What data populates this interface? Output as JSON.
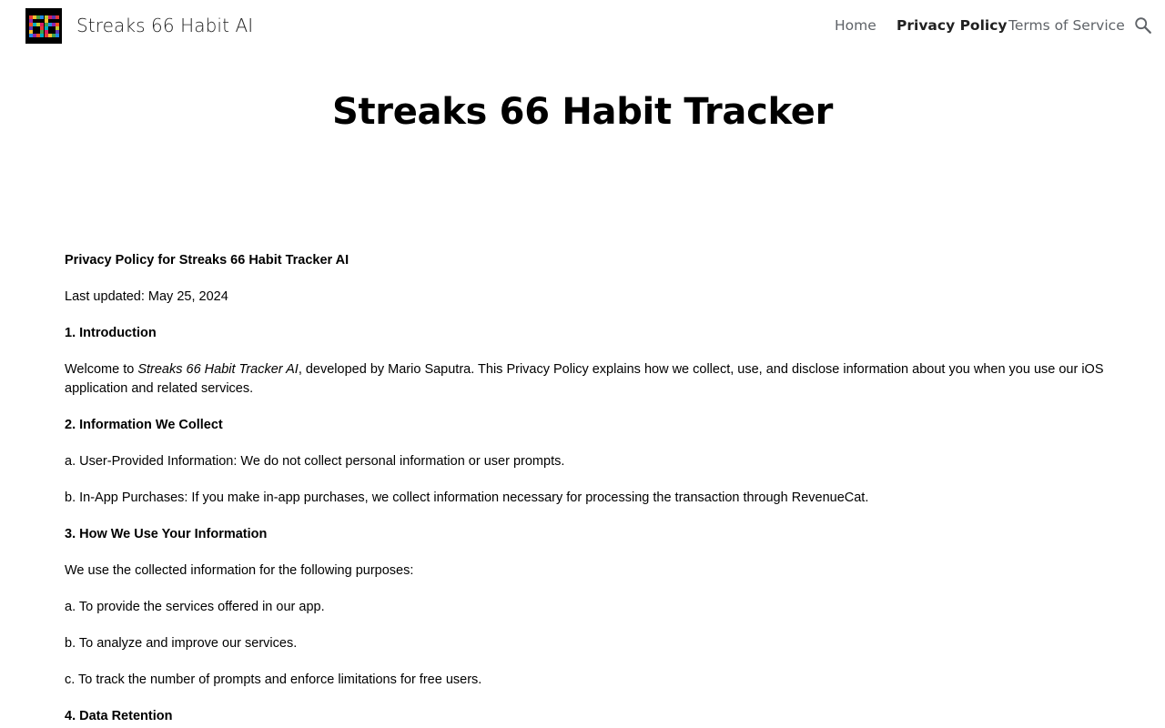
{
  "header": {
    "site_title": "Streaks 66 Habit AI",
    "nav": [
      {
        "label": "Home",
        "active": false
      },
      {
        "label": "Privacy Policy",
        "active": true
      },
      {
        "label": "Terms of Service",
        "active": false
      }
    ],
    "search_icon": "search-icon"
  },
  "page": {
    "title": "Streaks 66 Habit Tracker"
  },
  "policy": {
    "heading": "Privacy Policy for Streaks 66 Habit Tracker AI",
    "last_updated": "Last updated: May 25, 2024",
    "s1_title": "1. Introduction",
    "s1_text_prefix": "Welcome to ",
    "s1_text_app": "Streaks 66 Habit Tracker AI",
    "s1_text_suffix": ", developed by Mario Saputra. This Privacy Policy explains how we collect, use, and disclose information about you when you use our iOS application and related services.",
    "s2_title": "2. Information We Collect",
    "s2_a": "a. User-Provided Information: We do not collect personal information or user prompts.",
    "s2_b": "b. In-App Purchases: If you make in-app purchases, we collect information necessary for processing the transaction through RevenueCat.",
    "s3_title": "3. How We Use Your Information",
    "s3_intro": "We use the collected information for the following purposes:",
    "s3_a": "a. To provide the services offered in our app.",
    "s3_b": "b. To analyze and improve our services.",
    "s3_c": "c. To track the number of prompts and enforce limitations for free users.",
    "s4_title": "4. Data Retention"
  }
}
